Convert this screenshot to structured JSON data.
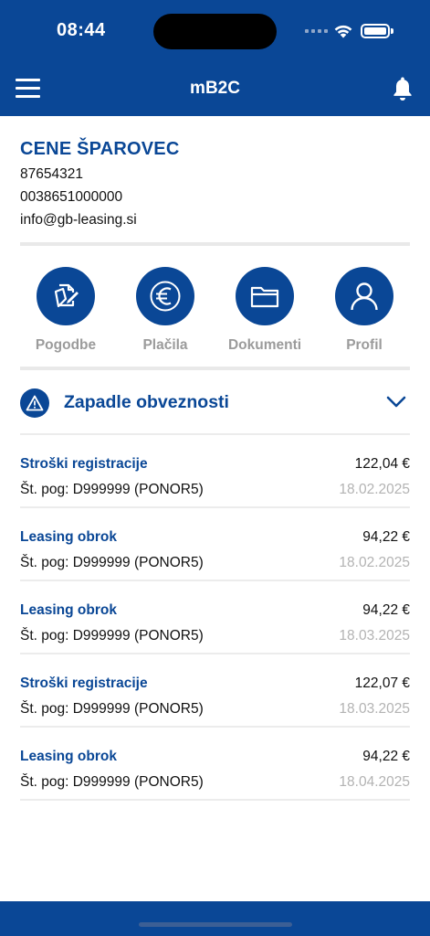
{
  "status_bar": {
    "time": "08:44"
  },
  "app_bar": {
    "title": "mB2C",
    "menu_icon": "hamburger-menu-icon",
    "bell_icon": "bell-icon"
  },
  "user": {
    "name": "CENE ŠPAROVEC",
    "id": "87654321",
    "phone": "0038651000000",
    "email": "info@gb-leasing.si"
  },
  "quick_actions": [
    {
      "label": "Pogodbe",
      "icon": "contract-edit-icon"
    },
    {
      "label": "Plačila",
      "icon": "euro-icon"
    },
    {
      "label": "Dokumenti",
      "icon": "folder-icon"
    },
    {
      "label": "Profil",
      "icon": "user-icon"
    }
  ],
  "section": {
    "title": "Zapadle obveznosti",
    "icon": "warning-icon",
    "toggle_icon": "chevron-down-icon"
  },
  "obligations": [
    {
      "title": "Stroški registracije",
      "contract": "Št. pog: D999999 (PONOR5)",
      "amount": "122,04 €",
      "date": "18.02.2025"
    },
    {
      "title": "Leasing obrok",
      "contract": "Št. pog: D999999 (PONOR5)",
      "amount": "94,22 €",
      "date": "18.02.2025"
    },
    {
      "title": "Leasing obrok",
      "contract": "Št. pog: D999999 (PONOR5)",
      "amount": "94,22 €",
      "date": "18.03.2025"
    },
    {
      "title": "Stroški registracije",
      "contract": "Št. pog: D999999 (PONOR5)",
      "amount": "122,07 €",
      "date": "18.03.2025"
    },
    {
      "title": "Leasing obrok",
      "contract": "Št. pog: D999999 (PONOR5)",
      "amount": "94,22 €",
      "date": "18.04.2025"
    }
  ],
  "colors": {
    "brand": "#0a4796",
    "muted": "#9b9b9b",
    "date": "#b3b3b3",
    "divider": "#ececec"
  }
}
